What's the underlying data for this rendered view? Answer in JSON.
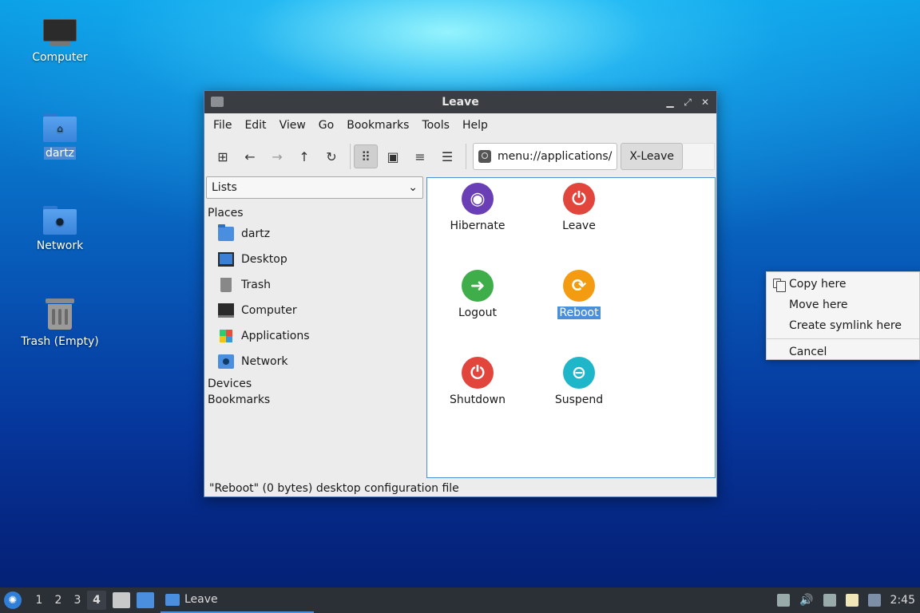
{
  "desktop": {
    "icons": [
      {
        "label": "Computer",
        "icon": "computer-icon"
      },
      {
        "label": "dartz",
        "icon": "home-folder-icon"
      },
      {
        "label": "Network",
        "icon": "network-folder-icon"
      },
      {
        "label": "Trash (Empty)",
        "icon": "trash-icon"
      }
    ]
  },
  "window": {
    "title": "Leave",
    "menu": [
      "File",
      "Edit",
      "View",
      "Go",
      "Bookmarks",
      "Tools",
      "Help"
    ],
    "toolbar": {
      "icons": [
        "new-window-icon",
        "back-arrow-icon",
        "forward-arrow-icon",
        "up-arrow-icon",
        "reload-icon",
        "icon-view-icon",
        "thumbnail-view-icon",
        "compact-view-icon",
        "detailed-list-view-icon"
      ],
      "path": "menu://applications/",
      "crumb": "X-Leave"
    },
    "side_pane": {
      "mode": "Lists",
      "places_heading": "Places",
      "places": [
        "dartz",
        "Desktop",
        "Trash",
        "Computer",
        "Applications",
        "Network"
      ],
      "devices_heading": "Devices",
      "bookmarks_heading": "Bookmarks"
    },
    "items": [
      {
        "label": "Hibernate",
        "color": "#6a3fb5",
        "icon": "hibernate-icon"
      },
      {
        "label": "Leave",
        "color": "#e2453c",
        "icon": "power-icon"
      },
      {
        "label": "Logout",
        "color": "#3fae4a",
        "icon": "logout-icon"
      },
      {
        "label": "Reboot",
        "color": "#f39c12",
        "icon": "reboot-icon",
        "selected": true
      },
      {
        "label": "Shutdown",
        "color": "#e2453c",
        "icon": "power-icon"
      },
      {
        "label": "Suspend",
        "color": "#1fb6c9",
        "icon": "suspend-icon"
      }
    ],
    "status": "\"Reboot\" (0 bytes) desktop configuration file"
  },
  "context_menu": {
    "items": [
      "Copy here",
      "Move here",
      "Create symlink here"
    ],
    "cancel": "Cancel"
  },
  "taskbar": {
    "workspaces": [
      "1",
      "2",
      "3",
      "4"
    ],
    "active_workspace": "4",
    "task": "Leave",
    "clock": "2:45"
  }
}
